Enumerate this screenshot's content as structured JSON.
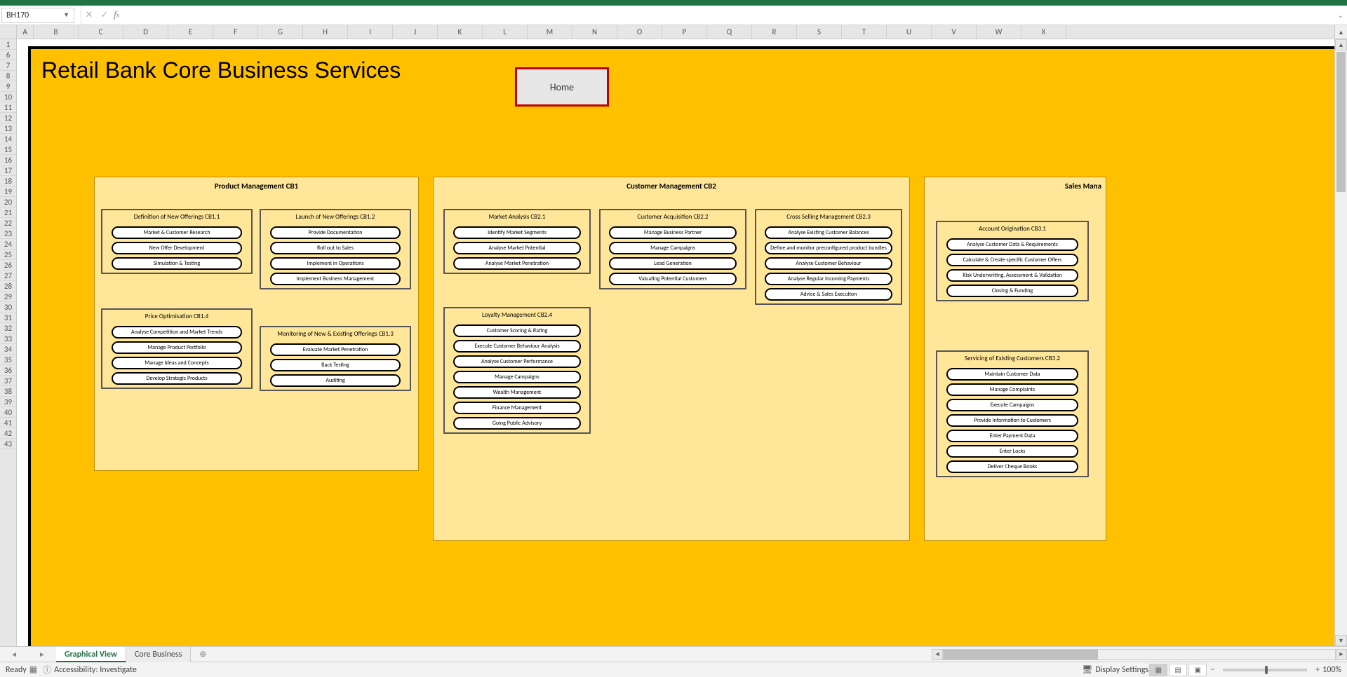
{
  "namebox": "BH170",
  "formula": "",
  "columns": [
    "A",
    "B",
    "C",
    "D",
    "E",
    "F",
    "G",
    "H",
    "I",
    "J",
    "K",
    "L",
    "M",
    "N",
    "O",
    "P",
    "Q",
    "R",
    "S",
    "T",
    "U",
    "V",
    "W",
    "X"
  ],
  "rows_start": 1,
  "rows_skip_to": 6,
  "rows_end": 43,
  "title": "Retail Bank Core Business Services",
  "home_button": "Home",
  "sections": {
    "pm": {
      "title": "Product Management CB1"
    },
    "cm": {
      "title": "Customer Management CB2"
    },
    "sm": {
      "title": "Sales Mana"
    }
  },
  "subboxes": {
    "pm11": {
      "title": "Definition of New Offerings CB1.1",
      "pills": [
        "Market & Customer Research",
        "New Offer Development",
        "Simulation & Testing"
      ]
    },
    "pm12": {
      "title": "Launch of New Offerings CB1.2",
      "pills": [
        "Provide Documentation",
        "Roll out to Sales",
        "Implement in Operations",
        "Implement Business Management"
      ]
    },
    "pm14": {
      "title": "Price Optimisation CB1.4",
      "pills": [
        "Analyse Competition and Market Trends",
        "Manage Product Portfolio",
        "Manage Ideas and Concepts",
        "Develop Strategic Products"
      ]
    },
    "pm13": {
      "title": "Monitoring of New & Existing Offerings CB1.3",
      "pills": [
        "Evaluate Market Penetration",
        "Back Testing",
        "Auditing"
      ]
    },
    "cm21": {
      "title": "Market Analysis CB2.1",
      "pills": [
        "Identify Market Segments",
        "Analyse Market Potential",
        "Analyse Market Penetration"
      ]
    },
    "cm22": {
      "title": "Customer Acquisition CB2.2",
      "pills": [
        "Manage Business Partner",
        "Manage Campaigns",
        "Lead Generation",
        "Valuating Potential Customers"
      ]
    },
    "cm23": {
      "title": "Cross Selling Management CB2.3",
      "pills": [
        "Analyse Existing Customer Balances",
        "Define and monitor preconfigured product bundles",
        "Analyse Customer Behaviour",
        "Analyse Regular Incoming Payments",
        "Advice & Sales Execution"
      ]
    },
    "cm24": {
      "title": "Loyalty Management CB2.4",
      "pills": [
        "Customer Scoring & Rating",
        "Execute Customer Behaviour Analysis",
        "Analyse Customer Performance",
        "Manage Campaigns",
        "Wealth Management",
        "Finance Management",
        "Going Public Advisory"
      ]
    },
    "sm31": {
      "title": "Account Origination CB3.1",
      "pills": [
        "Analyse Customer Data & Requirements",
        "Calculate & Create specific Customer Offers",
        "Risk Underwriting, Assessment & Validation",
        "Closing & Funding"
      ]
    },
    "sm32": {
      "title": "Servicing of Existing Customers CB3.2",
      "pills": [
        "Maintain Customer Data",
        "Manage Complaints",
        "Execute Campaigns",
        "Provide Information to Customers",
        "Enter Payment Data",
        "Enter Locks",
        "Deliver Cheque Books"
      ]
    }
  },
  "tabs": {
    "active": "Graphical View",
    "others": [
      "Core Business"
    ]
  },
  "status": {
    "ready": "Ready",
    "accessibility": "Accessibility: Investigate",
    "display_settings": "Display Settings",
    "zoom": "100%"
  }
}
